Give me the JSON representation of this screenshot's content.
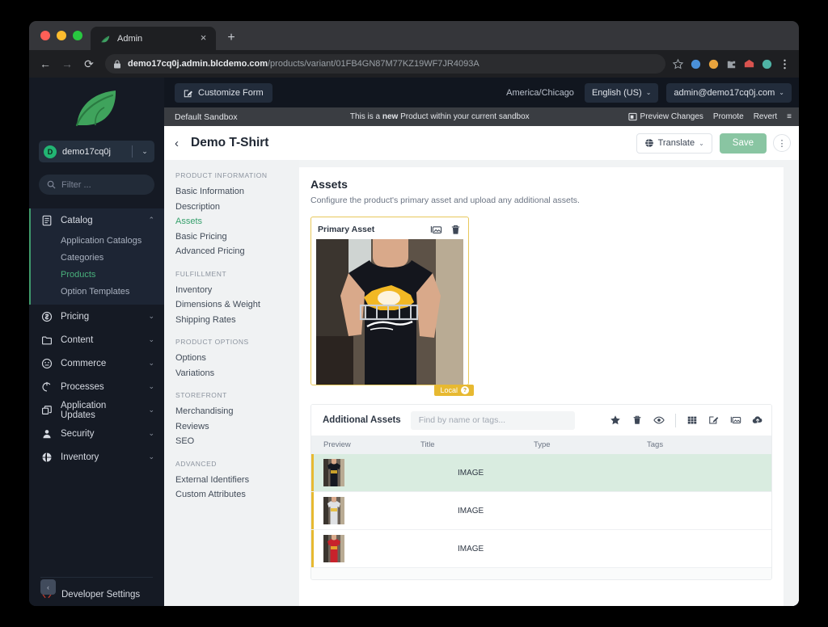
{
  "browser": {
    "tab_title": "Admin",
    "tab_close": "×",
    "new_tab": "+",
    "back": "←",
    "forward": "→",
    "reload": "⟳",
    "url_bold": "demo17cq0j.admin.blcdemo.com",
    "url_rest": "/products/variant/01FB4GN87M77KZ19WF7JR4093A"
  },
  "sidebar": {
    "tenant": {
      "initial": "D",
      "name": "demo17cq0j",
      "caret": "⌄"
    },
    "filter_placeholder": "Filter ...",
    "groups": [
      {
        "label": "Catalog",
        "icon": "catalog-icon",
        "expanded": true,
        "caret": "⌃",
        "items": [
          {
            "label": "Application Catalogs",
            "active": false
          },
          {
            "label": "Categories",
            "active": false
          },
          {
            "label": "Products",
            "active": true
          },
          {
            "label": "Option Templates",
            "active": false
          }
        ]
      },
      {
        "label": "Pricing",
        "icon": "pricing-icon",
        "expanded": false,
        "caret": "⌄",
        "items": []
      },
      {
        "label": "Content",
        "icon": "content-icon",
        "expanded": false,
        "caret": "⌄",
        "items": []
      },
      {
        "label": "Commerce",
        "icon": "commerce-icon",
        "expanded": false,
        "caret": "⌄",
        "items": []
      },
      {
        "label": "Processes",
        "icon": "processes-icon",
        "expanded": false,
        "caret": "⌄",
        "items": []
      },
      {
        "label": "Application Updates",
        "icon": "updates-icon",
        "expanded": false,
        "caret": "⌄",
        "items": []
      },
      {
        "label": "Security",
        "icon": "security-icon",
        "expanded": false,
        "caret": "⌄",
        "items": []
      },
      {
        "label": "Inventory",
        "icon": "inventory-icon",
        "expanded": false,
        "caret": "⌄",
        "items": []
      }
    ],
    "developer_settings": "Developer Settings",
    "collapse_caret": "‹"
  },
  "header": {
    "customize_form": "Customize Form",
    "timezone": "America/Chicago",
    "language": "English (US)",
    "account": "admin@demo17cq0j.com",
    "caret": "⌄"
  },
  "sandbox": {
    "name": "Default Sandbox",
    "msg_prefix": "This is a ",
    "msg_bold": "new",
    "msg_suffix": " Product within your current sandbox",
    "preview_changes": "Preview Changes",
    "promote": "Promote",
    "revert": "Revert",
    "menu": "≡"
  },
  "page": {
    "back": "‹",
    "title": "Demo T-Shirt",
    "translate": "Translate",
    "translate_caret": "⌄",
    "save": "Save",
    "kebab": "⋮"
  },
  "section_nav": [
    {
      "group": "PRODUCT INFORMATION",
      "items": [
        {
          "label": "Basic Information",
          "active": false
        },
        {
          "label": "Description",
          "active": false
        },
        {
          "label": "Assets",
          "active": true
        },
        {
          "label": "Basic Pricing",
          "active": false
        },
        {
          "label": "Advanced Pricing",
          "active": false
        }
      ]
    },
    {
      "group": "FULFILLMENT",
      "items": [
        {
          "label": "Inventory",
          "active": false
        },
        {
          "label": "Dimensions & Weight",
          "active": false
        },
        {
          "label": "Shipping Rates",
          "active": false
        }
      ]
    },
    {
      "group": "PRODUCT OPTIONS",
      "items": [
        {
          "label": "Options",
          "active": false
        },
        {
          "label": "Variations",
          "active": false
        }
      ]
    },
    {
      "group": "STOREFRONT",
      "items": [
        {
          "label": "Merchandising",
          "active": false
        },
        {
          "label": "Reviews",
          "active": false
        },
        {
          "label": "SEO",
          "active": false
        }
      ]
    },
    {
      "group": "ADVANCED",
      "items": [
        {
          "label": "External Identifiers",
          "active": false
        },
        {
          "label": "Custom Attributes",
          "active": false
        }
      ]
    }
  ],
  "assets": {
    "title": "Assets",
    "subtitle": "Configure the product's primary asset and upload any additional assets.",
    "primary_label": "Primary Asset",
    "primary_badge": "Local",
    "primary_badge_help": "?",
    "additional_title": "Additional Assets",
    "search_placeholder": "Find by name or tags...",
    "columns": [
      "Preview",
      "Title",
      "Type",
      "Tags"
    ],
    "rows": [
      {
        "shirt_color": "#141821",
        "title": "",
        "type": "IMAGE",
        "tags": "",
        "selected": true
      },
      {
        "shirt_color": "#dfe1e4",
        "title": "",
        "type": "IMAGE",
        "tags": "",
        "selected": false
      },
      {
        "shirt_color": "#c8232c",
        "title": "",
        "type": "IMAGE",
        "tags": "",
        "selected": false
      }
    ]
  },
  "colors": {
    "accent_green": "#36a06c",
    "sandbox_yellow": "#e7b931",
    "save_green": "#89c5a2",
    "row_selected": "#d9ece0"
  }
}
